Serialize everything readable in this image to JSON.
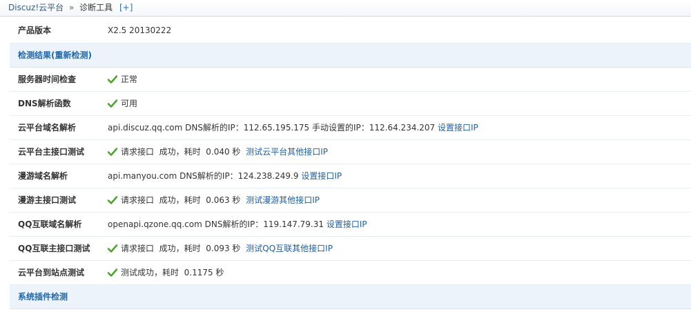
{
  "breadcrumb": {
    "root": "Discuz!云平台",
    "sep": "»",
    "current": "诊断工具",
    "plus": "[+]"
  },
  "product": {
    "label": "产品版本",
    "value": "X2.5 20130222"
  },
  "section_results": {
    "title": "检测结果(重新检测)"
  },
  "rows": {
    "server_time": {
      "label": "服务器时间检查",
      "status": "正常"
    },
    "dns_func": {
      "label": "DNS解析函数",
      "status": "可用"
    },
    "cloud_domain": {
      "label": "云平台域名解析",
      "text": "api.discuz.qq.com DNS解析的IP：112.65.195.175 手动设置的IP：112.64.234.207",
      "link": "设置接口IP"
    },
    "cloud_main": {
      "label": "云平台主接口测试",
      "text": "请求接口  成功，耗时  0.040 秒",
      "link": "测试云平台其他接口IP"
    },
    "manyou_domain": {
      "label": "漫游域名解析",
      "text": "api.manyou.com DNS解析的IP：124.238.249.9",
      "link": "设置接口IP"
    },
    "manyou_main": {
      "label": "漫游主接口测试",
      "text": "请求接口  成功，耗时  0.063 秒",
      "link": "测试漫游其他接口IP"
    },
    "qq_domain": {
      "label": "QQ互联域名解析",
      "text": "openapi.qzone.qq.com DNS解析的IP：119.147.79.31",
      "link": "设置接口IP"
    },
    "qq_main": {
      "label": "QQ互联主接口测试",
      "text": "请求接口  成功，耗时  0.093 秒",
      "link": "测试QQ互联其他接口IP"
    },
    "site_test": {
      "label": "云平台到站点测试",
      "text": "测试成功，耗时  0.1175 秒"
    }
  },
  "section_plugins": {
    "title": "系统插件检测"
  },
  "colors": {
    "check_green": "#4aa52a",
    "link_blue": "#1f5fa6",
    "section_bg": "#edf3fa"
  },
  "icons": {
    "status_ok": "checkmark-icon"
  }
}
